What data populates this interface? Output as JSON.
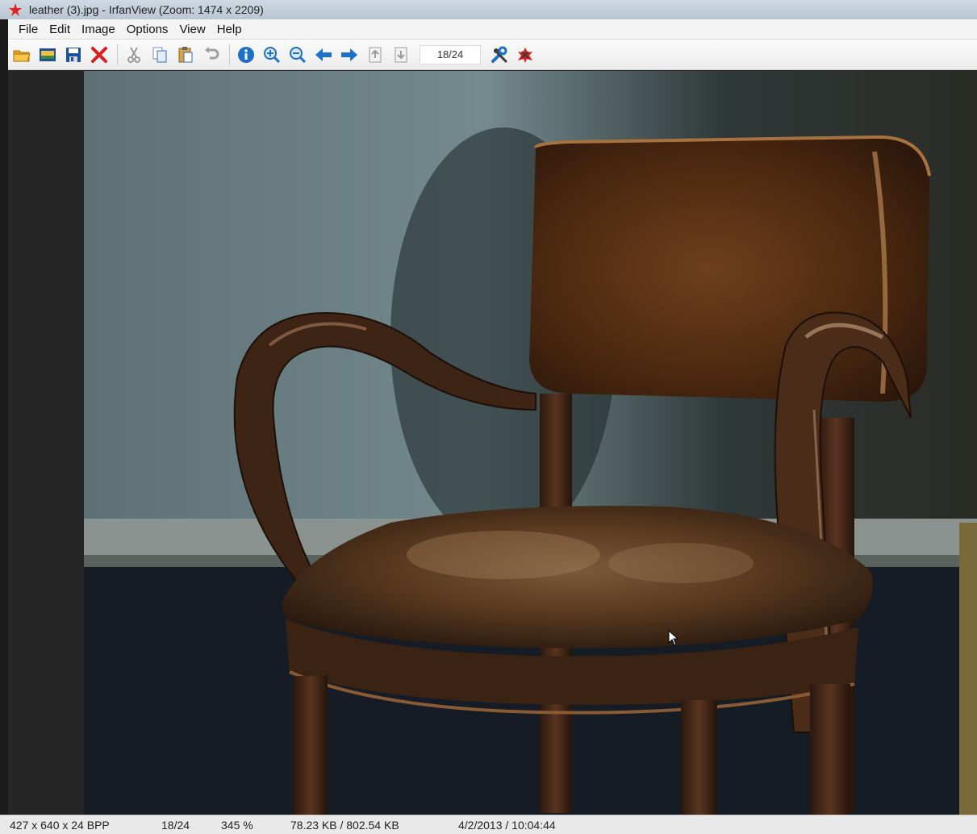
{
  "window": {
    "title": "leather (3).jpg - IrfanView (Zoom: 1474 x 2209)"
  },
  "menu": {
    "items": [
      "File",
      "Edit",
      "Image",
      "Options",
      "View",
      "Help"
    ]
  },
  "toolbar": {
    "page_counter": "18/24",
    "icons": [
      "open-folder-icon",
      "thumbnails-icon",
      "save-icon",
      "delete-icon",
      "cut-icon",
      "copy-icon",
      "paste-icon",
      "undo-icon",
      "info-icon",
      "zoom-in-icon",
      "zoom-out-icon",
      "previous-arrow-icon",
      "next-arrow-icon",
      "first-file-icon",
      "last-file-icon",
      "properties-icon",
      "exit-icon"
    ]
  },
  "image": {
    "subject": "leather chair photo"
  },
  "statusbar": {
    "dimensions": "427 x 640 x 24 BPP",
    "page": "18/24",
    "zoom": "345 %",
    "filesize": "78.23 KB / 802.54 KB",
    "datetime": "4/2/2013 / 10:04:44"
  },
  "colors": {
    "accent": "#1e6fc7",
    "delete": "#d81e1e",
    "save": "#1c4f9c"
  }
}
